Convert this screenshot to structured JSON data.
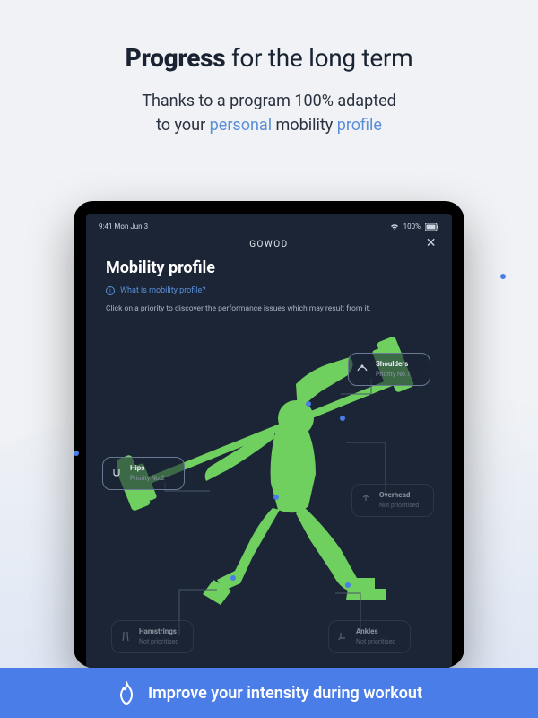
{
  "hero": {
    "title_bold": "Progress",
    "title_rest": " for the long term",
    "sub_line1": "Thanks to a program 100% adapted",
    "sub_line2_a": "to your ",
    "sub_line2_hl1": "personal",
    "sub_line2_b": " mobility ",
    "sub_line2_hl2": "profile"
  },
  "tablet": {
    "status_time": "9:41  Mon Jun 3",
    "app_name": "GOWOD",
    "page_title": "Mobility profile",
    "info_link": "What is mobility profile?",
    "description": "Click on a priority to discover the performance issues which may result from it.",
    "callouts": {
      "shoulders": {
        "title": "Shoulders",
        "sub": "Priority No.1"
      },
      "hips": {
        "title": "Hips",
        "sub": "Priority No.2"
      },
      "overhead": {
        "title": "Overhead",
        "sub": "Not prioritised"
      },
      "hamstrings": {
        "title": "Hamstrings",
        "sub": "Not prioritised"
      },
      "ankles": {
        "title": "Ankles",
        "sub": "Not prioritised"
      }
    }
  },
  "bottom_bar": {
    "text": "Improve your intensity during workout"
  }
}
